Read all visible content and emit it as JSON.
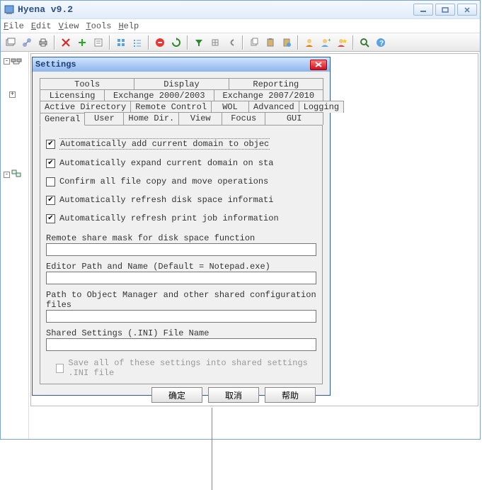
{
  "window": {
    "title": "Hyena v9.2"
  },
  "menu": {
    "file": "File",
    "edit": "Edit",
    "view": "View",
    "tools": "Tools",
    "help": "Help"
  },
  "dialog": {
    "title": "Settings",
    "tabs_row1": {
      "tools": "Tools",
      "display": "Display",
      "reporting": "Reporting"
    },
    "tabs_row2": {
      "licensing": "Licensing",
      "ex2000": "Exchange 2000/2003",
      "ex2007": "Exchange 2007/2010"
    },
    "tabs_row3": {
      "ad": "Active Directory",
      "remote": "Remote Control",
      "wol": "WOL",
      "advanced": "Advanced",
      "logging": "Logging"
    },
    "tabs_row4": {
      "general": "General",
      "user": "User",
      "home": "Home Dir.",
      "view": "View",
      "focus": "Focus",
      "gui": "GUI"
    },
    "checks": {
      "c1": "Automatically add current domain to objec",
      "c2": "Automatically expand current domain on sta",
      "c3": "Confirm all file copy and move operations",
      "c4": "Automatically refresh disk space informati",
      "c5": "Automatically refresh print job information"
    },
    "fields": {
      "f1": "Remote share mask for disk space function",
      "f2": "Editor Path and Name (Default = Notepad.exe)",
      "f3": "Path to Object Manager and other shared configuration files",
      "f4": "Shared Settings (.INI) File Name"
    },
    "save_shared": "Save all of these settings into shared settings .INI file",
    "buttons": {
      "ok": "确定",
      "cancel": "取消",
      "help": "帮助"
    }
  }
}
